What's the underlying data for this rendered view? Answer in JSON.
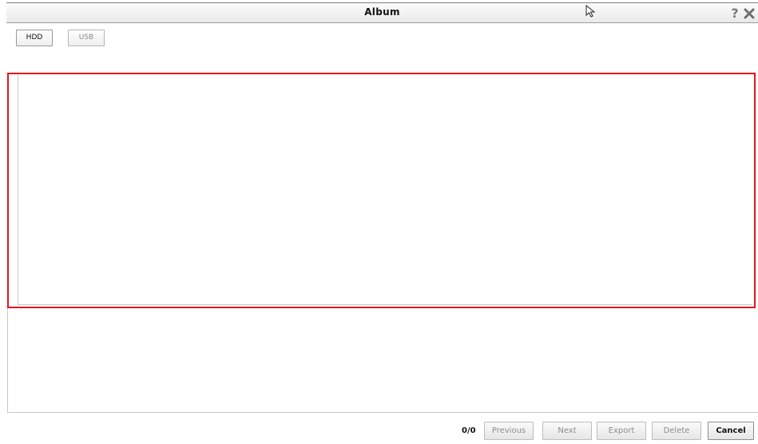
{
  "window": {
    "title": "Album"
  },
  "tabs": [
    {
      "label": "HDD",
      "active": true
    },
    {
      "label": "USB",
      "active": false
    }
  ],
  "album": {
    "items": []
  },
  "footer": {
    "page_count": "0/0",
    "previous_label": "Previous",
    "next_label": "Next",
    "export_label": "Export",
    "delete_label": "Delete",
    "cancel_label": "Cancel"
  },
  "icons": {
    "help": "help-icon",
    "close": "close-icon",
    "cursor": "mouse-cursor-icon"
  },
  "colors": {
    "highlight": "#e3161b",
    "disabled_text": "#8c8c8c"
  }
}
